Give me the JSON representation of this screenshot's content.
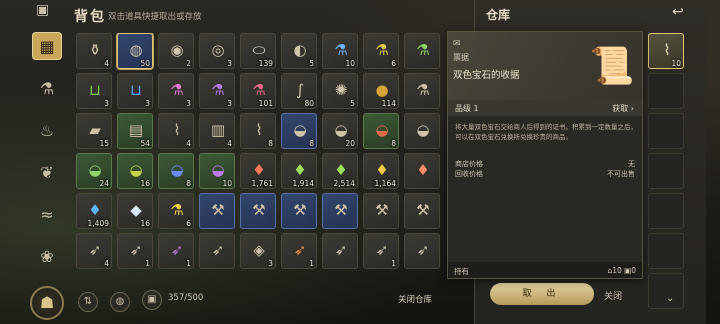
{
  "backpack": {
    "title": "背包",
    "hint": "双击道具快捷取出或存放",
    "capacity": "357/500",
    "close_warehouse": "关闭仓库"
  },
  "rail": [
    {
      "name": "menu-icon",
      "glyph": "▦",
      "active": true
    },
    {
      "name": "pouch-icon",
      "glyph": "⚗",
      "active": false
    },
    {
      "name": "potion-icon",
      "glyph": "♨",
      "active": false
    },
    {
      "name": "herb-icon",
      "glyph": "❦",
      "active": false
    },
    {
      "name": "fish-icon",
      "glyph": "≈",
      "active": false
    },
    {
      "name": "flower-icon",
      "glyph": "❀",
      "active": false
    }
  ],
  "items": [
    {
      "icon": "bottle",
      "glyph": "⚱",
      "count": "4",
      "style": ""
    },
    {
      "icon": "pouch",
      "glyph": "◍",
      "count": "50",
      "style": "b sel"
    },
    {
      "icon": "dish",
      "glyph": "◉",
      "count": "2",
      "style": ""
    },
    {
      "icon": "meat",
      "glyph": "◎",
      "count": "3",
      "style": ""
    },
    {
      "icon": "egg",
      "glyph": "⬭",
      "count": "139",
      "style": ""
    },
    {
      "icon": "stew",
      "glyph": "◐",
      "count": "5",
      "style": ""
    },
    {
      "icon": "blue-potion",
      "glyph": "⚗",
      "count": "10",
      "style": ""
    },
    {
      "icon": "yellow-potion",
      "glyph": "⚗",
      "count": "6",
      "style": ""
    },
    {
      "icon": "green-potion",
      "glyph": "⚗",
      "count": "",
      "style": ""
    },
    {
      "icon": "green-cup",
      "glyph": "⊔",
      "count": "3",
      "style": ""
    },
    {
      "icon": "blue-cup",
      "glyph": "⊔",
      "count": "3",
      "style": ""
    },
    {
      "icon": "pink-potion",
      "glyph": "⚗",
      "count": "3",
      "style": ""
    },
    {
      "icon": "purple-potion",
      "glyph": "⚗",
      "count": "3",
      "style": ""
    },
    {
      "icon": "red-potion",
      "glyph": "⚗",
      "count": "101",
      "style": ""
    },
    {
      "icon": "worm",
      "glyph": "∫",
      "count": "80",
      "style": ""
    },
    {
      "icon": "bug",
      "glyph": "✺",
      "count": "5",
      "style": ""
    },
    {
      "icon": "orb",
      "glyph": "●",
      "count": "114",
      "style": ""
    },
    {
      "icon": "blue-vial",
      "glyph": "⚗",
      "count": "",
      "style": ""
    },
    {
      "icon": "boots",
      "glyph": "▰",
      "count": "15",
      "style": ""
    },
    {
      "icon": "tome",
      "glyph": "▤",
      "count": "54",
      "style": "g"
    },
    {
      "icon": "scroll",
      "glyph": "⌇",
      "count": "4",
      "style": ""
    },
    {
      "icon": "map",
      "glyph": "▥",
      "count": "4",
      "style": ""
    },
    {
      "icon": "scroll-2",
      "glyph": "⌇",
      "count": "8",
      "style": ""
    },
    {
      "icon": "dye-bowl",
      "glyph": "◒",
      "count": "8",
      "style": "b"
    },
    {
      "icon": "bowl",
      "glyph": "◒",
      "count": "20",
      "style": ""
    },
    {
      "icon": "red-bowl",
      "glyph": "◒",
      "count": "8",
      "style": "g"
    },
    {
      "icon": "pot",
      "glyph": "◒",
      "count": "",
      "style": ""
    },
    {
      "icon": "green-dye",
      "glyph": "◒",
      "count": "24",
      "style": "g"
    },
    {
      "icon": "green-dye-2",
      "glyph": "◒",
      "count": "16",
      "style": "g"
    },
    {
      "icon": "blue-dye",
      "glyph": "◒",
      "count": "8",
      "style": "g"
    },
    {
      "icon": "purple-dye",
      "glyph": "◒",
      "count": "10",
      "style": "g"
    },
    {
      "icon": "red-gem",
      "glyph": "♦",
      "count": "1,761",
      "style": ""
    },
    {
      "icon": "green-gem",
      "glyph": "♦",
      "count": "1,914",
      "style": ""
    },
    {
      "icon": "green-gem-2",
      "glyph": "♦",
      "count": "2,514",
      "style": ""
    },
    {
      "icon": "yellow-gem",
      "glyph": "♦",
      "count": "1,164",
      "style": ""
    },
    {
      "icon": "gem",
      "glyph": "♦",
      "count": "",
      "style": ""
    },
    {
      "icon": "blue-gem",
      "glyph": "♦",
      "count": "1,409",
      "style": ""
    },
    {
      "icon": "crystal",
      "glyph": "◆",
      "count": "16",
      "style": ""
    },
    {
      "icon": "yellow-flask",
      "glyph": "⚗",
      "count": "6",
      "style": ""
    },
    {
      "icon": "anvil",
      "glyph": "⚒",
      "count": "",
      "style": "b"
    },
    {
      "icon": "anvil-2",
      "glyph": "⚒",
      "count": "",
      "style": "b"
    },
    {
      "icon": "anvil-3",
      "glyph": "⚒",
      "count": "",
      "style": "b"
    },
    {
      "icon": "anvil-4",
      "glyph": "⚒",
      "count": "",
      "style": "b"
    },
    {
      "icon": "anvil-5",
      "glyph": "⚒",
      "count": "",
      "style": ""
    },
    {
      "icon": "anvil-6",
      "glyph": "⚒",
      "count": "",
      "style": ""
    },
    {
      "icon": "fish",
      "glyph": "➶",
      "count": "4",
      "style": ""
    },
    {
      "icon": "fish-2",
      "glyph": "➶",
      "count": "1",
      "style": ""
    },
    {
      "icon": "purple-fish",
      "glyph": "➶",
      "count": "1",
      "style": ""
    },
    {
      "icon": "fish-3",
      "glyph": "➶",
      "count": "",
      "style": ""
    },
    {
      "icon": "flatfish",
      "glyph": "◈",
      "count": "3",
      "style": ""
    },
    {
      "icon": "red-fish",
      "glyph": "➶",
      "count": "1",
      "style": ""
    },
    {
      "icon": "fish-4",
      "glyph": "➶",
      "count": "",
      "style": ""
    },
    {
      "icon": "fish-5",
      "glyph": "➶",
      "count": "1",
      "style": ""
    },
    {
      "icon": "fish-6",
      "glyph": "➶",
      "count": "",
      "style": ""
    }
  ],
  "warehouse": {
    "title": "仓库",
    "slot_count": "10",
    "take_label": "取 出"
  },
  "tooltip": {
    "type": "票据",
    "name": "双色宝石的收据",
    "grade": "品级 1",
    "obtain": "获取 ›",
    "desc": "将大量双色宝石交给商人后得到的证书。积累到一定数量之后，可以在双色宝石兑换所兑换珍贵的商品。",
    "shop_price_label": "商店价格",
    "shop_price_value": "无",
    "recycle_label": "回收价格",
    "recycle_value": "不可出售",
    "hold_label": "持有",
    "hold_a": "⌂10",
    "hold_b": "▣0",
    "close_label": "关闭"
  }
}
